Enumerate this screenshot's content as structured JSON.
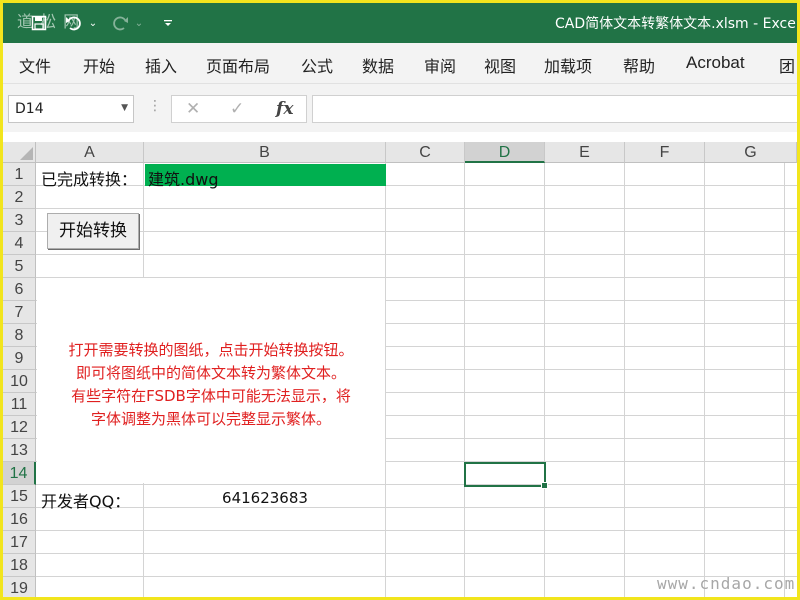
{
  "watermark": {
    "logo": "道 松 网",
    "url": "www.cndao.com"
  },
  "window": {
    "title": "CAD简体文本转繁体文本.xlsm  -  Exce"
  },
  "ribbon": {
    "tabs": [
      "文件",
      "开始",
      "插入",
      "页面布局",
      "公式",
      "数据",
      "审阅",
      "视图",
      "加载项",
      "帮助",
      "Acrobat",
      "团"
    ]
  },
  "formula_bar": {
    "name_box": "D14",
    "formula": ""
  },
  "columns": [
    "A",
    "B",
    "C",
    "D",
    "E",
    "F",
    "G"
  ],
  "rows": [
    "1",
    "2",
    "3",
    "4",
    "5",
    "6",
    "7",
    "8",
    "9",
    "10",
    "11",
    "12",
    "13",
    "14",
    "15",
    "16",
    "17",
    "18",
    "19"
  ],
  "selected_cell": {
    "col": "D",
    "row": "14"
  },
  "cells": {
    "a1": "已完成转换：",
    "b1": "建筑.dwg",
    "a15": "开发者QQ：",
    "b15": "641623683"
  },
  "colors": {
    "excel_green": "#217346",
    "progress_fill": "#00b050",
    "notice_red": "#e02020"
  },
  "button": {
    "label": "开始转换"
  },
  "notice_lines": [
    "打开需要转换的图纸，点击开始转换按钮。",
    "即可将图纸中的简体文本转为繁体文本。",
    "有些字符在FSDB字体中可能无法显示，将",
    "字体调整为黑体可以完整显示繁体。"
  ]
}
